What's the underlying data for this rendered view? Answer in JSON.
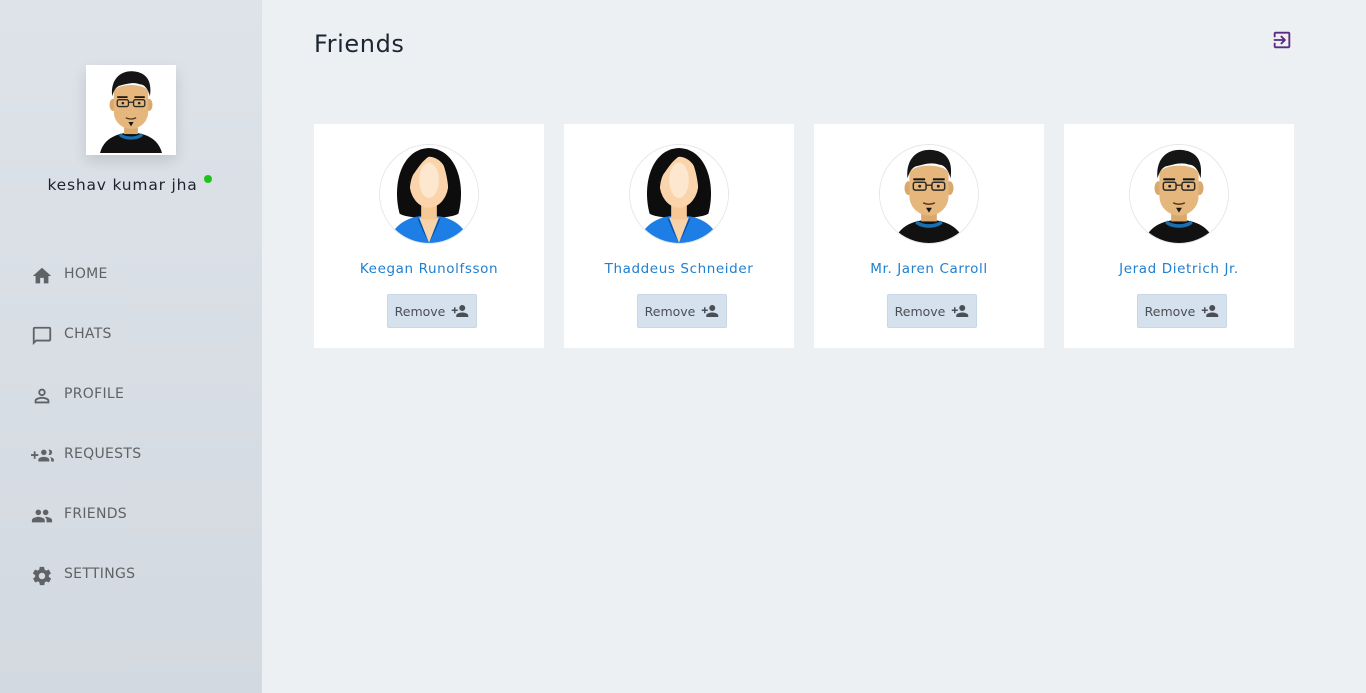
{
  "user": {
    "name": "keshav kumar jha",
    "status_color": "#1ec31e"
  },
  "nav": {
    "items": [
      {
        "label": "HOME",
        "icon": "home-icon"
      },
      {
        "label": "CHATS",
        "icon": "chat-icon"
      },
      {
        "label": "PROFILE",
        "icon": "person-icon"
      },
      {
        "label": "REQUESTS",
        "icon": "add-group-icon"
      },
      {
        "label": "FRIENDS",
        "icon": "people-icon"
      },
      {
        "label": "SETTINGS",
        "icon": "gear-icon"
      }
    ]
  },
  "header": {
    "title": "Friends",
    "logout_icon": "logout-icon"
  },
  "friends": [
    {
      "name": "Keegan Runolfsson",
      "avatar": "female-avatar",
      "action": "Remove"
    },
    {
      "name": "Thaddeus Schneider",
      "avatar": "female-avatar",
      "action": "Remove"
    },
    {
      "name": "Mr. Jaren Carroll",
      "avatar": "male-avatar",
      "action": "Remove"
    },
    {
      "name": "Jerad Dietrich Jr.",
      "avatar": "male-avatar",
      "action": "Remove"
    }
  ],
  "colors": {
    "accent_link": "#1f7fd0",
    "logout_icon": "#5a2a82",
    "button_bg": "#d6e1ee"
  }
}
